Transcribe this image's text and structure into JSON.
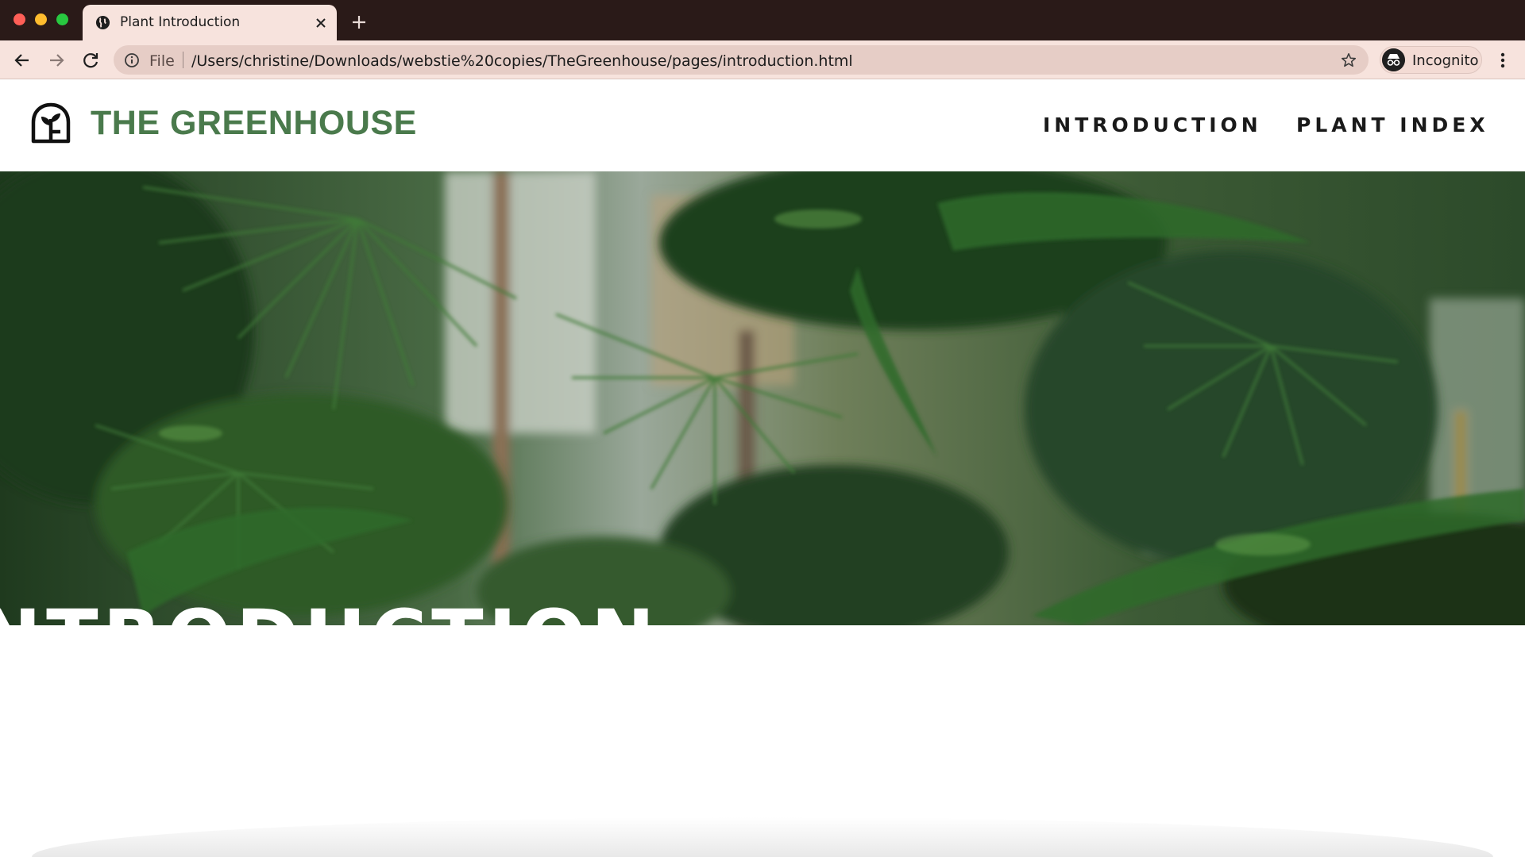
{
  "browser": {
    "tab_title": "Plant Introduction",
    "address_scheme_label": "File",
    "address_url": "/Users/christine/Downloads/webstie%20copies/TheGreenhouse/pages/introduction.html",
    "profile_label": "Incognito",
    "icons": [
      "globe-icon",
      "close-icon",
      "plus-icon",
      "back-arrow-icon",
      "forward-arrow-icon",
      "reload-icon",
      "info-icon",
      "star-icon",
      "incognito-icon",
      "more-vert-icon"
    ]
  },
  "site": {
    "name": "THE GREENHOUSE",
    "brand_color": "#4a7a4c",
    "nav": [
      {
        "label": "INTRODUCTION"
      },
      {
        "label": "PLANT INDEX"
      }
    ]
  },
  "hero": {
    "title": "INTRODUCTION",
    "image": "blurred photograph of tropical palm leaves inside a greenhouse"
  }
}
